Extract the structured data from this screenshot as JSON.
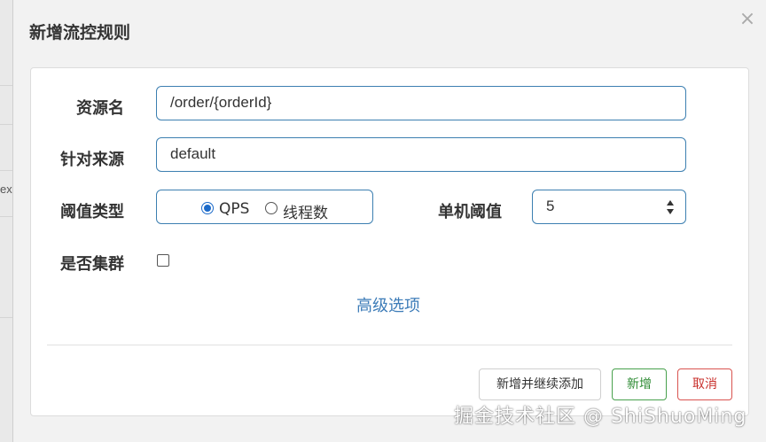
{
  "background": {
    "fragment_text": "ex"
  },
  "dialog": {
    "title": "新增流控规则",
    "close_glyph": "×"
  },
  "form": {
    "resource_name": {
      "label": "资源名",
      "value": "/order/{orderId}"
    },
    "limit_app": {
      "label": "针对来源",
      "value": "default"
    },
    "threshold_type": {
      "label": "阈值类型",
      "options": [
        "QPS",
        "线程数"
      ],
      "selected": "QPS"
    },
    "single_threshold": {
      "label": "单机阈值",
      "value": "5"
    },
    "cluster_mode": {
      "label": "是否集群",
      "checked": false
    },
    "advanced_link": "高级选项"
  },
  "footer": {
    "add_continue_label": "新增并继续添加",
    "add_label": "新增",
    "cancel_label": "取消"
  },
  "watermark": "掘金技术社区 @ ShiShuoMing",
  "colors": {
    "accent": "#3c7fb1",
    "link": "#3d7cb8",
    "success": "#2e8b34",
    "danger": "#c9302c",
    "radio_checked": "#1b6ac9"
  }
}
